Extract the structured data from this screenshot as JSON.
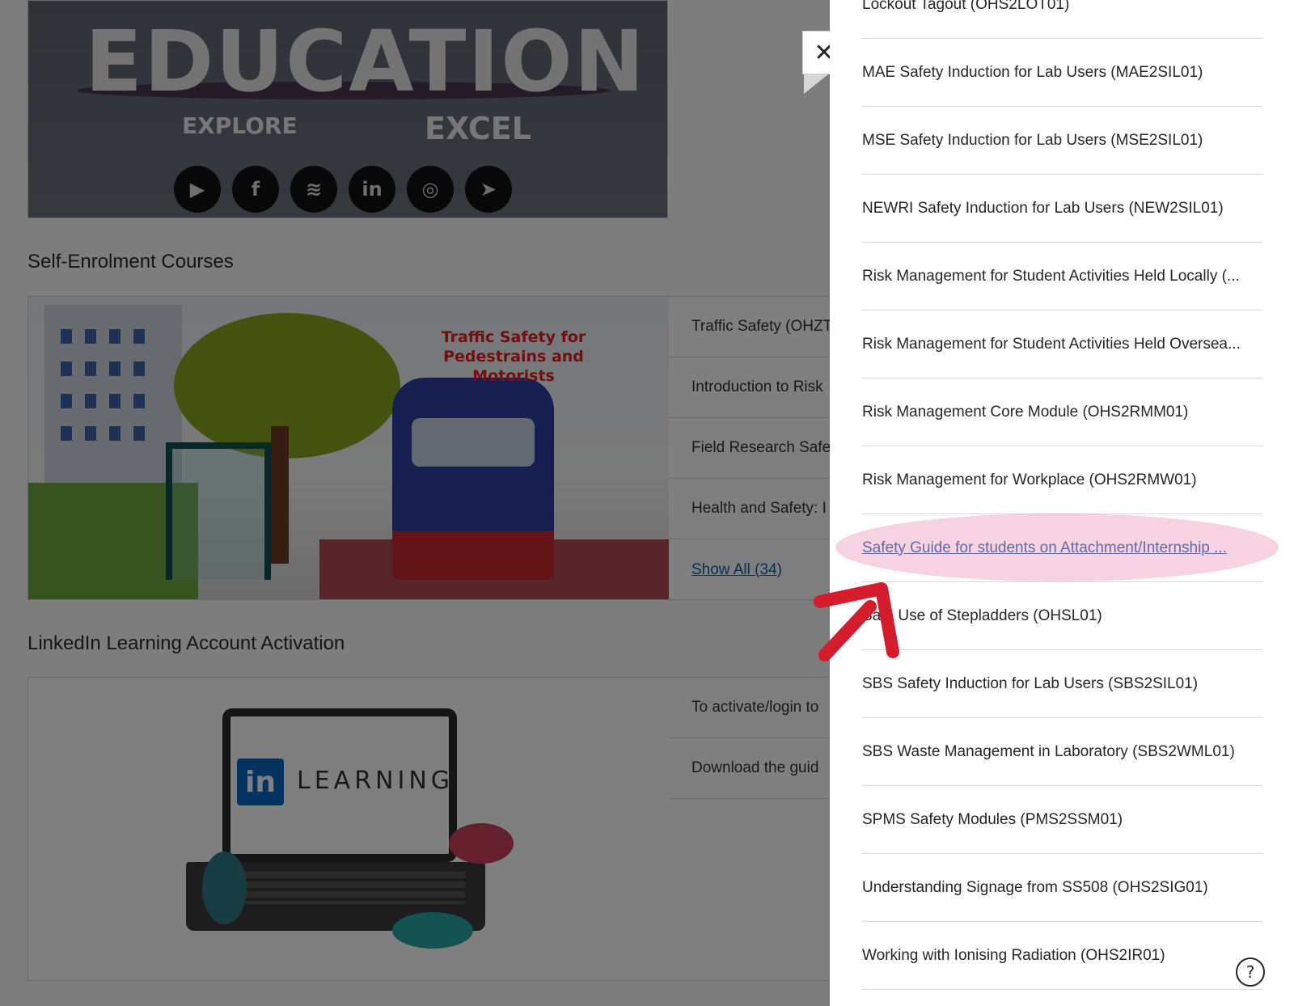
{
  "banner": {
    "word": "EDUCATION",
    "explore": "EXPLORE",
    "excel": "EXCEL",
    "social": [
      "youtube-icon",
      "facebook-icon",
      "spotify-icon",
      "linkedin-icon",
      "instagram-icon",
      "telegram-icon"
    ]
  },
  "self_enrolment": {
    "title": "Self-Enrolment Courses",
    "image_caption_line1": "Traffic Safety for",
    "image_caption_line2": "Pedestrains and Motorists",
    "rows": [
      "Traffic Safety (OHZT",
      "Introduction to Risk",
      "Field Research Safe",
      "Health and Safety: I"
    ],
    "show_all": "Show All (34)"
  },
  "linkedin": {
    "title": "LinkedIn Learning Account Activation",
    "logo": "in",
    "word": "LEARNING",
    "rows": [
      "To activate/login to",
      "Download the guid"
    ]
  },
  "close": {
    "glyph": "✕"
  },
  "panel": {
    "items": [
      "Lockout Tagout (OHS2LOT01)",
      "MAE Safety Induction for Lab Users (MAE2SIL01)",
      "MSE Safety Induction for Lab Users (MSE2SIL01)",
      "NEWRI Safety Induction for Lab Users (NEW2SIL01)",
      "Risk Management for Student Activities Held Locally (...",
      "Risk Management for Student Activities Held Oversea...",
      "Risk Management Core Module (OHS2RMM01)",
      "Risk Management for Workplace (OHS2RMW01)",
      "Safety Guide for students on Attachment/Internship ...",
      "Safe Use of Stepladders (OHSL01)",
      "SBS Safety Induction for Lab Users (SBS2SIL01)",
      "SBS Waste Management in Laboratory (SBS2WML01)",
      "SPMS Safety Modules (PMS2SSM01)",
      "Understanding Signage from SS508 (OHS2SIG01)",
      "Working with Ionising Radiation (OHS2IR01)"
    ],
    "active_index": 8
  },
  "help": {
    "glyph": "?"
  },
  "colors": {
    "link": "#1a5ca8",
    "highlight": "#e882aa",
    "arrow": "#d41c2c"
  }
}
